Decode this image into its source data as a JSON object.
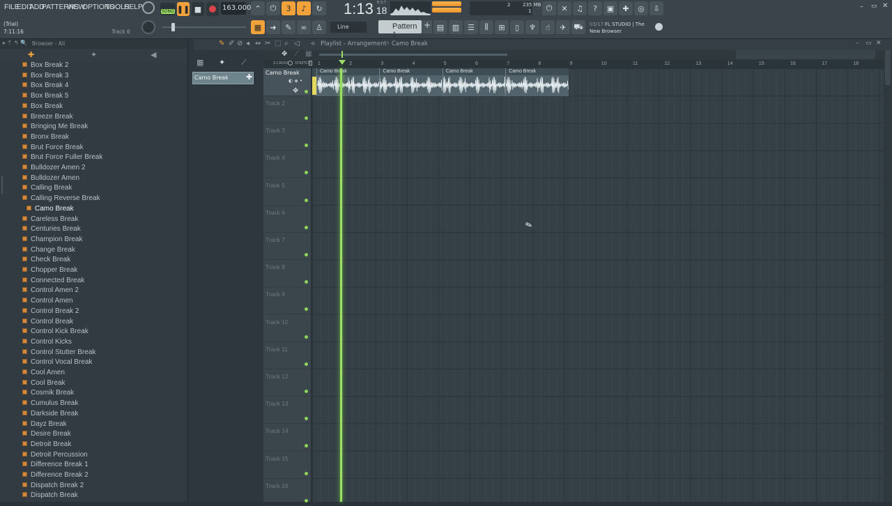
{
  "menu": [
    "FILE",
    "EDIT",
    "ADD",
    "PATTERNS",
    "VIEW",
    "OPTIONS",
    "TOOLS",
    "HELP"
  ],
  "transport": {
    "song_label": "SONG",
    "tempo": "163.000",
    "time": "1:13",
    "time_small": "18",
    "time_unit": "B:S:T",
    "memory": "235 MB",
    "cpu_value": "2",
    "poly_value": "1"
  },
  "info": {
    "trial": "(Trial)",
    "time": "7:11:16",
    "track": "Track 6"
  },
  "pattern": {
    "label": "Pattern 1",
    "snap": "Line"
  },
  "news": {
    "date": "03/17",
    "line1": "FL STUDIO | The",
    "line2": "New Browser"
  },
  "browser": {
    "title": "Browser - All",
    "items": [
      "Box Break 2",
      "Box Break 3",
      "Box Break 4",
      "Box Break 5",
      "Box Break",
      "Breeze Break",
      "Bringing Me Break",
      "Bronx Break",
      "Brut Force Break",
      "Brut Force Fuller Break",
      "Bulldozer Amen 2",
      "Bulldozer Amen",
      "Calling Break",
      "Calling Reverse Break",
      "Camo Break",
      "Careless Break",
      "Centuries Break",
      "Champion Break",
      "Change Break",
      "Check Break",
      "Chopper Break",
      "Connected Break",
      "Control Amen 2",
      "Control Amen",
      "Control Break 2",
      "Control Break",
      "Control Kick Break",
      "Control Kicks",
      "Control Stutter Break",
      "Control Vocal Break",
      "Cool Amen",
      "Cool Break",
      "Cosmik Break",
      "Cumulus Break",
      "Darkside Break",
      "Dayz Break",
      "Desire Break",
      "Detroit Break",
      "Detroit Percussion",
      "Difference Break 1",
      "Difference Break 2",
      "Dispatch Break 2",
      "Dispatch Break"
    ],
    "selected": "Camo Break"
  },
  "channel_clip": "Camo Break",
  "playlist": {
    "breadcrumb": "Playlist - Arrangement",
    "breadcrumb_sep": "›",
    "current": "Camo Break",
    "zcross": "Z-CROSS",
    "stretch": "STRETCH",
    "track1": "Camo Break",
    "tracks": [
      "Track 2",
      "Track 3",
      "Track 4",
      "Track 5",
      "Track 6",
      "Track 7",
      "Track 8",
      "Track 9",
      "Track 10",
      "Track 11",
      "Track 12",
      "Track 13",
      "Track 14",
      "Track 15",
      "Track 16"
    ],
    "ruler": [
      "1",
      "2",
      "3",
      "4",
      "5",
      "6",
      "7",
      "8",
      "9",
      "10",
      "11",
      "12",
      "13",
      "14",
      "15",
      "16",
      "17",
      "18"
    ],
    "clips": [
      "Camo Break",
      "Camo Break",
      "Camo Break",
      "Camo Break"
    ]
  },
  "colors": {
    "accent": "#f2a23a",
    "playhead": "#9be064",
    "clip": "#52636b"
  }
}
